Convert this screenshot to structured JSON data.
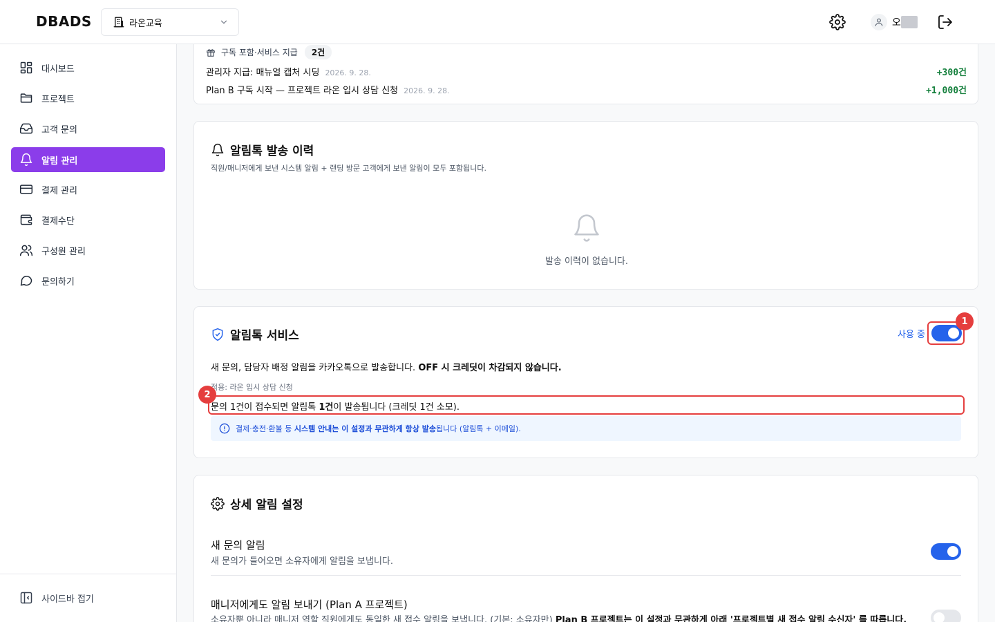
{
  "header": {
    "logo": "DBADS",
    "org_name": "라온교육",
    "user_name": "오"
  },
  "sidebar": {
    "items": [
      {
        "label": "대시보드",
        "icon": "grid-icon"
      },
      {
        "label": "프로젝트",
        "icon": "folder-icon"
      },
      {
        "label": "고객 문의",
        "icon": "inbox-icon"
      },
      {
        "label": "알림 관리",
        "icon": "bell-icon",
        "active": true
      },
      {
        "label": "결제 관리",
        "icon": "credit-card-icon"
      },
      {
        "label": "결제수단",
        "icon": "wallet-icon"
      },
      {
        "label": "구성원 관리",
        "icon": "users-icon"
      },
      {
        "label": "문의하기",
        "icon": "message-circle-icon"
      }
    ],
    "collapse_label": "사이드바 접기"
  },
  "credits": {
    "package_label": "구독 포함·서비스 지급",
    "package_count": "2건",
    "rows": [
      {
        "title": "관리자 지급: 매뉴얼 캡처 시딩",
        "date": "2026. 9. 28.",
        "amount": "+300건"
      },
      {
        "title": "Plan B 구독 시작 — 프로젝트 라온 입시 상담 신청",
        "date": "2026. 9. 28.",
        "amount": "+1,000건"
      }
    ]
  },
  "history": {
    "title": "알림톡 발송 이력",
    "subtitle": "직원/매니저에게 보낸 시스템 알림 + 랜딩 방문 고객에게 보낸 알림이 모두 포함됩니다.",
    "empty_text": "발송 이력이 없습니다."
  },
  "service": {
    "title": "알림톡 서비스",
    "toggle_label": "사용 중",
    "toggle_on": true,
    "desc_normal": "새 문의, 담당자 배정 알림을 카카오톡으로 발송합니다. ",
    "desc_bold": "OFF 시 크레딧이 차감되지 않습니다.",
    "applied": "적용: 라온 입시 상담 신청",
    "rule_pre": "문의 1건이 접수되면 알림톡 ",
    "rule_bold": "1건",
    "rule_post": "이 발송됩니다 (크레딧 1건 소모).",
    "info_pre": "결제·충전·환불 등 ",
    "info_bold": "시스템 안내는 이 설정과 무관하게 항상 발송",
    "info_post": "됩니다 (알림톡 + 이메일).",
    "marker1": "1",
    "marker2": "2"
  },
  "detail": {
    "title": "상세 알림 설정",
    "settings": [
      {
        "title": "새 문의 알림",
        "desc": "새 문의가 들어오면 소유자에게 알림을 보냅니다.",
        "on": true
      },
      {
        "title": "매니저에게도 알림 보내기 (Plan A 프로젝트)",
        "desc_pre": "소유자뿐 아니라 매니저 역할 직원에게도 동일한 새 접수 알림을 보냅니다. (기본: 소유자만) ",
        "desc_bold": "Plan B 프로젝트는 이 설정과 무관하게 아래 '프로젝트별 새 접수 알림 수신자' 를 따릅니다.",
        "on": false
      }
    ]
  },
  "colors": {
    "accent": "#8b3dea",
    "primary": "#2563eb",
    "positive": "#15803d",
    "highlight": "#e53e3e"
  }
}
